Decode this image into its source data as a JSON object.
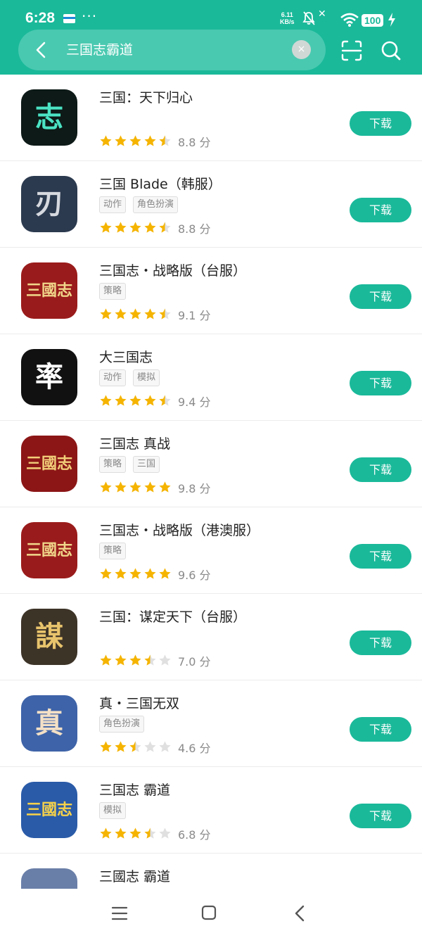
{
  "status_bar": {
    "time": "6:28",
    "dots": "···",
    "speed_value": "6.11",
    "speed_unit": "KB/s",
    "battery": "100"
  },
  "search": {
    "query": "三国志霸道",
    "clear": "×"
  },
  "icons": {
    "back": "back-arrow-icon",
    "clear": "close-icon",
    "scan": "scan-icon",
    "search": "search-icon"
  },
  "colors": {
    "accent": "#1ab99a",
    "star": "#f5b400",
    "star_empty": "#e0e0e0"
  },
  "download_label": "下载",
  "apps": [
    {
      "name": "三国：天下归心",
      "tags": [],
      "stars": 4.5,
      "rating": "8.8 分",
      "icon_bg": "#0d1a17",
      "icon_fg": "#4be3c4",
      "icon_glyph": "志"
    },
    {
      "name": "三国 Blade（韩服）",
      "tags": [
        "动作",
        "角色扮演"
      ],
      "stars": 4.5,
      "rating": "8.8 分",
      "icon_bg": "#2c3a4f",
      "icon_fg": "#d6d9df",
      "icon_glyph": "刃"
    },
    {
      "name": "三国志・战略版（台服）",
      "tags": [
        "策略"
      ],
      "stars": 4.5,
      "rating": "9.1 分",
      "icon_bg": "#9a1b1b",
      "icon_fg": "#f0d68a",
      "icon_glyph": "三國志"
    },
    {
      "name": "大三国志",
      "tags": [
        "动作",
        "模拟"
      ],
      "stars": 4.5,
      "rating": "9.4 分",
      "icon_bg": "#111111",
      "icon_fg": "#ffffff",
      "icon_glyph": "率"
    },
    {
      "name": "三国志 真战",
      "tags": [
        "策略",
        "三国"
      ],
      "stars": 5,
      "rating": "9.8 分",
      "icon_bg": "#8c1616",
      "icon_fg": "#f2cf7a",
      "icon_glyph": "三國志"
    },
    {
      "name": "三国志・战略版（港澳服）",
      "tags": [
        "策略"
      ],
      "stars": 5,
      "rating": "9.6 分",
      "icon_bg": "#9a1b1b",
      "icon_fg": "#f0d68a",
      "icon_glyph": "三國志"
    },
    {
      "name": "三国：谋定天下（台服）",
      "tags": [],
      "stars": 3.5,
      "rating": "7.0 分",
      "icon_bg": "#3d3428",
      "icon_fg": "#e8c46c",
      "icon_glyph": "謀"
    },
    {
      "name": "真・三国无双",
      "tags": [
        "角色扮演"
      ],
      "stars": 2.5,
      "rating": "4.6 分",
      "icon_bg": "#3e63a8",
      "icon_fg": "#f3e0c6",
      "icon_glyph": "真"
    },
    {
      "name": "三国志 霸道",
      "tags": [
        "模拟"
      ],
      "stars": 3.5,
      "rating": "6.8 分",
      "icon_bg": "#2a5ba8",
      "icon_fg": "#f6d24a",
      "icon_glyph": "三國志"
    },
    {
      "name": "三國志 霸道",
      "tags": [],
      "stars": 0,
      "rating": "",
      "icon_bg": "#6a7fa8",
      "icon_fg": "#ffffff",
      "icon_glyph": ""
    }
  ]
}
